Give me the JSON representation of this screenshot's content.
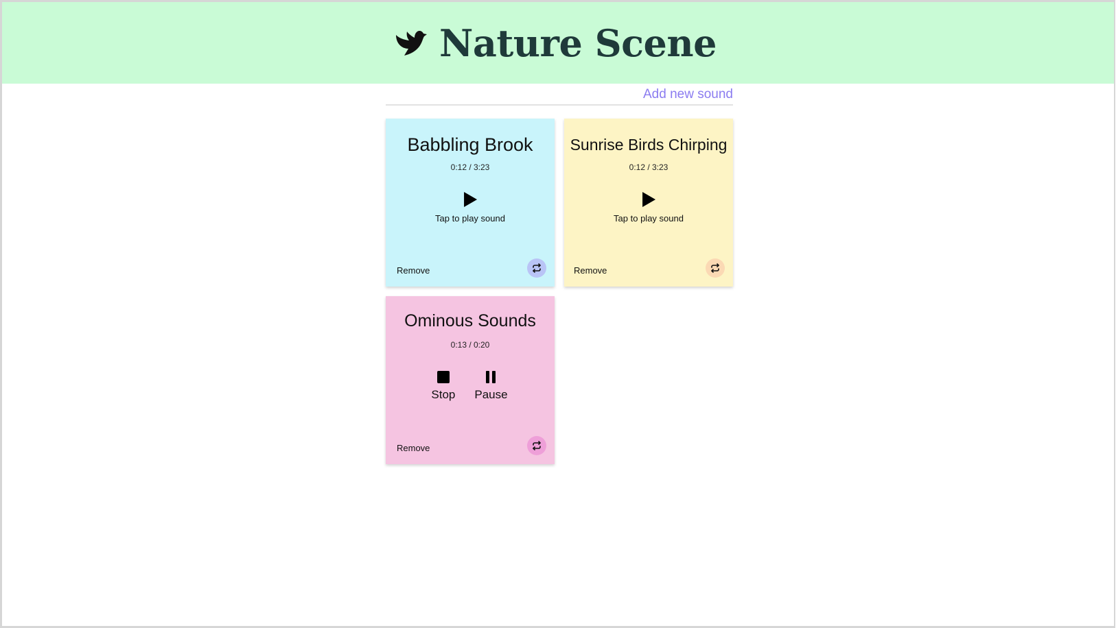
{
  "header": {
    "title": "Nature Scene",
    "logo_icon": "bird-icon",
    "background": "#c9fbd6"
  },
  "toolbar": {
    "add_label": "Add new sound",
    "add_color": "#8b7cf0"
  },
  "sounds": [
    {
      "title": "Babbling Brook",
      "time": "0:12 / 3:23",
      "state": "stopped",
      "play_hint": "Tap to play sound",
      "remove_label": "Remove",
      "background": "#c9f4fb",
      "loop_color": "#b9c4f6",
      "loop_icon": "repeat-icon"
    },
    {
      "title": "Sunrise Birds Chirping",
      "time": "0:12 / 3:23",
      "state": "stopped",
      "play_hint": "Tap to play sound",
      "remove_label": "Remove",
      "background": "#fdf4c5",
      "loop_color": "#fbd9b4",
      "loop_icon": "repeat-icon"
    },
    {
      "title": "Ominous Sounds",
      "time": "0:13 / 0:20",
      "state": "playing",
      "stop_label": "Stop",
      "pause_label": "Pause",
      "remove_label": "Remove",
      "background": "#f5c4e1",
      "loop_color": "#ee9fd8",
      "loop_icon": "repeat-icon"
    }
  ]
}
